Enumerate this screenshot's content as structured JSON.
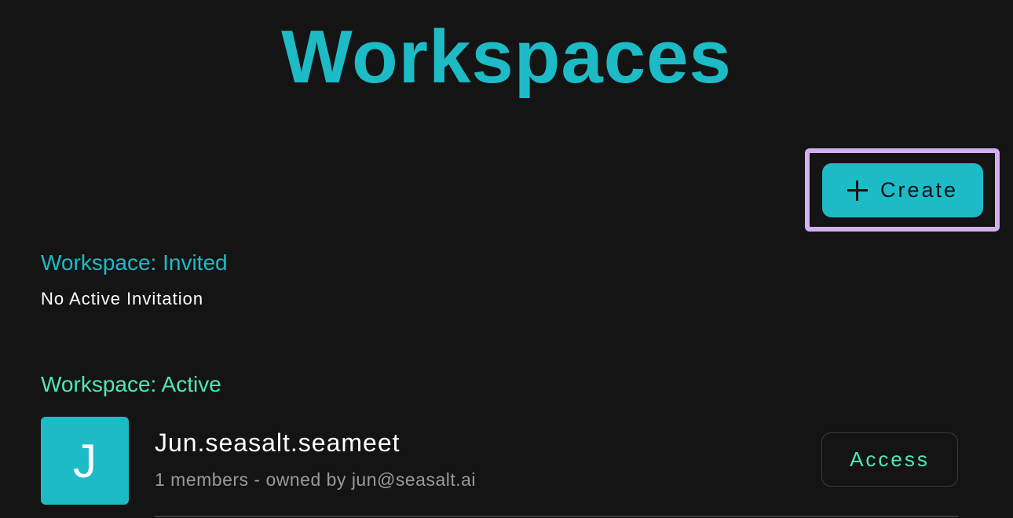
{
  "page": {
    "title": "Workspaces"
  },
  "toolbar": {
    "create_label": "Create",
    "create_icon": "plus-icon"
  },
  "invited": {
    "heading": "Workspace: Invited",
    "empty_text": "No Active Invitation"
  },
  "active": {
    "heading": "Workspace: Active",
    "workspaces": [
      {
        "avatar_letter": "J",
        "name": "Jun.seasalt.seameet",
        "meta": "1 members - owned by jun@seasalt.ai",
        "access_label": "Access"
      }
    ]
  },
  "colors": {
    "background": "#141414",
    "accent": "#1cbbc6",
    "active_green": "#4ee8b4",
    "highlight": "#d4aef0"
  }
}
